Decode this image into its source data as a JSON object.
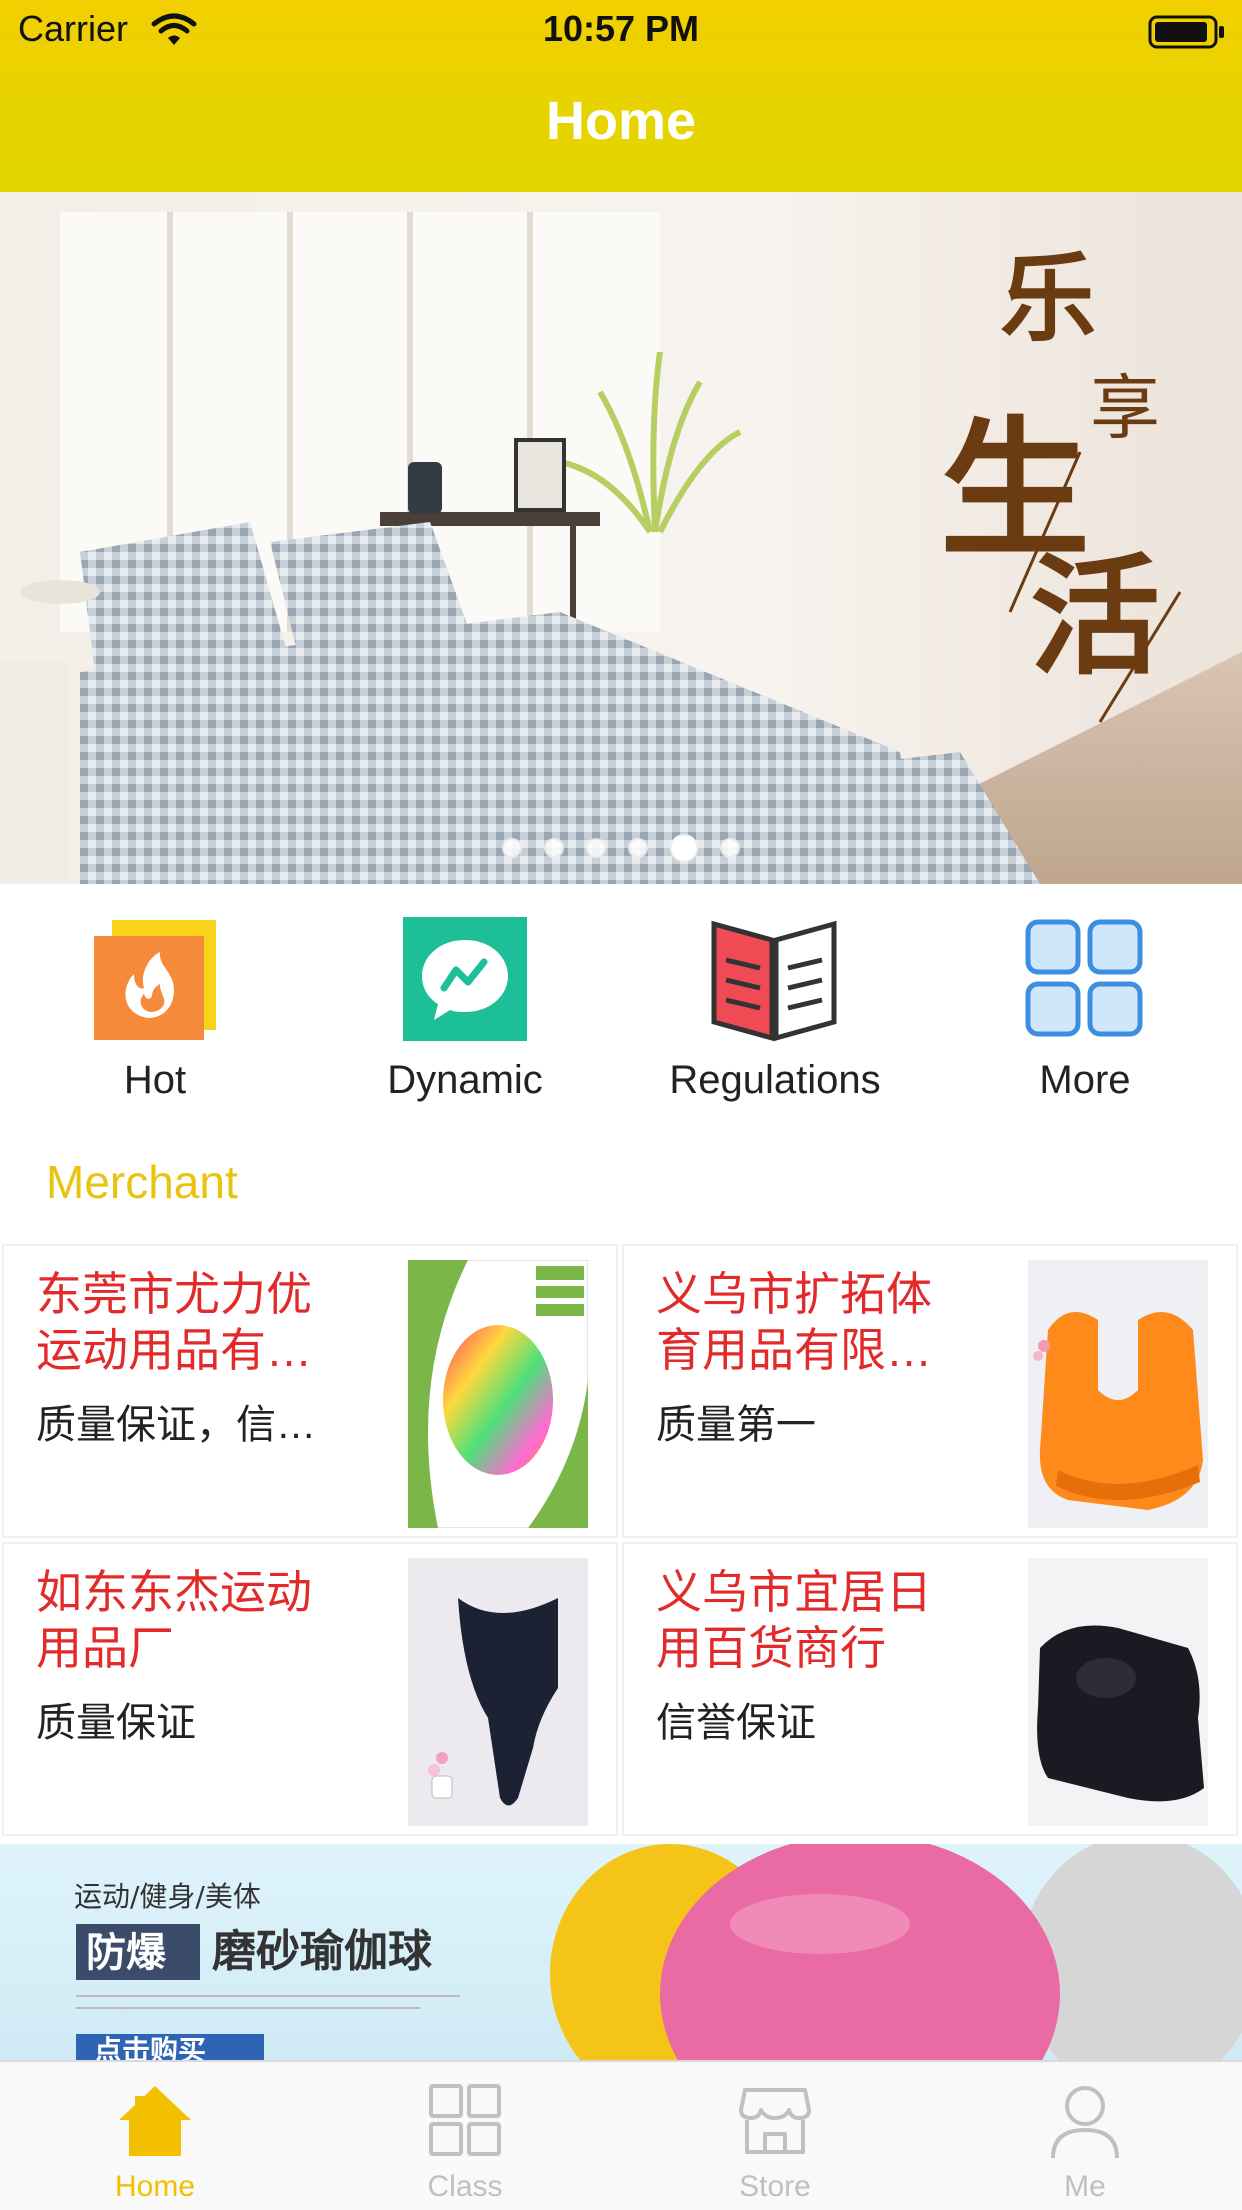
{
  "status_bar": {
    "carrier": "Carrier",
    "time": "10:57 PM",
    "wifi_icon": "wifi-icon",
    "battery_icon": "battery-icon"
  },
  "nav": {
    "title": "Home"
  },
  "banner": {
    "page_count": 6,
    "active_page": 5,
    "text_art": "乐享生活"
  },
  "quick_links": [
    {
      "label": "Hot",
      "icon": "flame-icon"
    },
    {
      "label": "Dynamic",
      "icon": "chat-trend-icon"
    },
    {
      "label": "Regulations",
      "icon": "book-icon"
    },
    {
      "label": "More",
      "icon": "grid-icon"
    }
  ],
  "merchant": {
    "title": "Merchant",
    "items": [
      {
        "name": "东莞市尤力优运动用品有…",
        "desc": "质量保证，信…"
      },
      {
        "name": "义乌市扩拓体育用品有限…",
        "desc": "质量第一"
      },
      {
        "name": "如东东杰运动用品厂",
        "desc": "质量保证"
      },
      {
        "name": "义乌市宜居日用百货商行",
        "desc": "信誉保证"
      }
    ]
  },
  "promo": {
    "line1": "运动/健身/美体",
    "tag": "防爆",
    "headline": "磨砂瑜伽球",
    "cta": "点击购买"
  },
  "tab_bar": {
    "tabs": [
      {
        "label": "Home",
        "icon": "home-icon",
        "active": true
      },
      {
        "label": "Class",
        "icon": "class-grid-icon",
        "active": false
      },
      {
        "label": "Store",
        "icon": "store-icon",
        "active": false
      },
      {
        "label": "Me",
        "icon": "user-icon",
        "active": false
      }
    ]
  },
  "colors": {
    "accent": "#f2c000",
    "merchant_name": "#e22a2a",
    "header": "#e6d300"
  }
}
